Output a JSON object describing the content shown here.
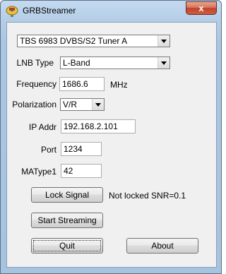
{
  "window": {
    "title": "GRBStreamer",
    "close_glyph": "x",
    "icon": "satellite-dish-icon"
  },
  "tuner": {
    "selected": "TBS 6983 DVBS/S2 Tuner A"
  },
  "lnb_type": {
    "label": "LNB Type",
    "selected": "L-Band"
  },
  "frequency": {
    "label": "Frequency",
    "value": "1686.6",
    "unit": "MHz"
  },
  "polarization": {
    "label": "Polarization",
    "selected": "V/R"
  },
  "ip_addr": {
    "label": "IP Addr",
    "value": "192.168.2.101"
  },
  "port": {
    "label": "Port",
    "value": "1234"
  },
  "matype": {
    "label": "MAType1",
    "value": "42"
  },
  "buttons": {
    "lock_signal": "Lock Signal",
    "start_streaming": "Start Streaming",
    "quit": "Quit",
    "about": "About"
  },
  "status": {
    "lock_text": "Not locked SNR=0.1"
  }
}
